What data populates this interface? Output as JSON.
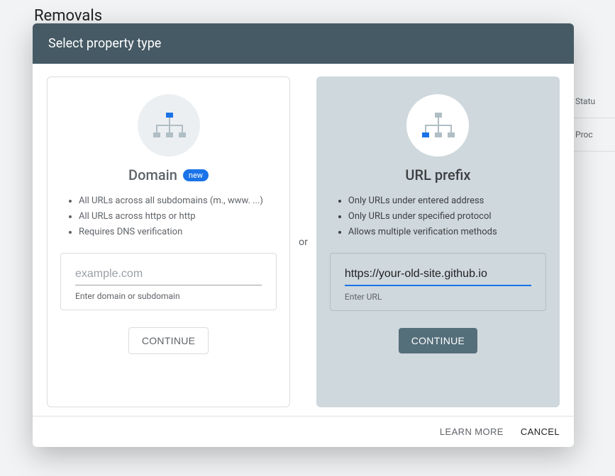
{
  "background": {
    "page_title": "Removals",
    "right_col": {
      "status": "Statu",
      "proc": "Proc"
    }
  },
  "modal": {
    "title": "Select property type",
    "or_label": "or",
    "domain_card": {
      "title": "Domain",
      "badge": "new",
      "bullets": [
        "All URLs across all subdomains (m., www. ...)",
        "All URLs across https or http",
        "Requires DNS verification"
      ],
      "placeholder": "example.com",
      "hint": "Enter domain or subdomain",
      "button": "CONTINUE"
    },
    "url_card": {
      "title": "URL prefix",
      "bullets": [
        "Only URLs under entered address",
        "Only URLs under specified protocol",
        "Allows multiple verification methods"
      ],
      "value": "https://your-old-site.github.io",
      "hint": "Enter URL",
      "button": "CONTINUE"
    },
    "footer": {
      "learn_more": "LEARN MORE",
      "cancel": "CANCEL"
    }
  }
}
